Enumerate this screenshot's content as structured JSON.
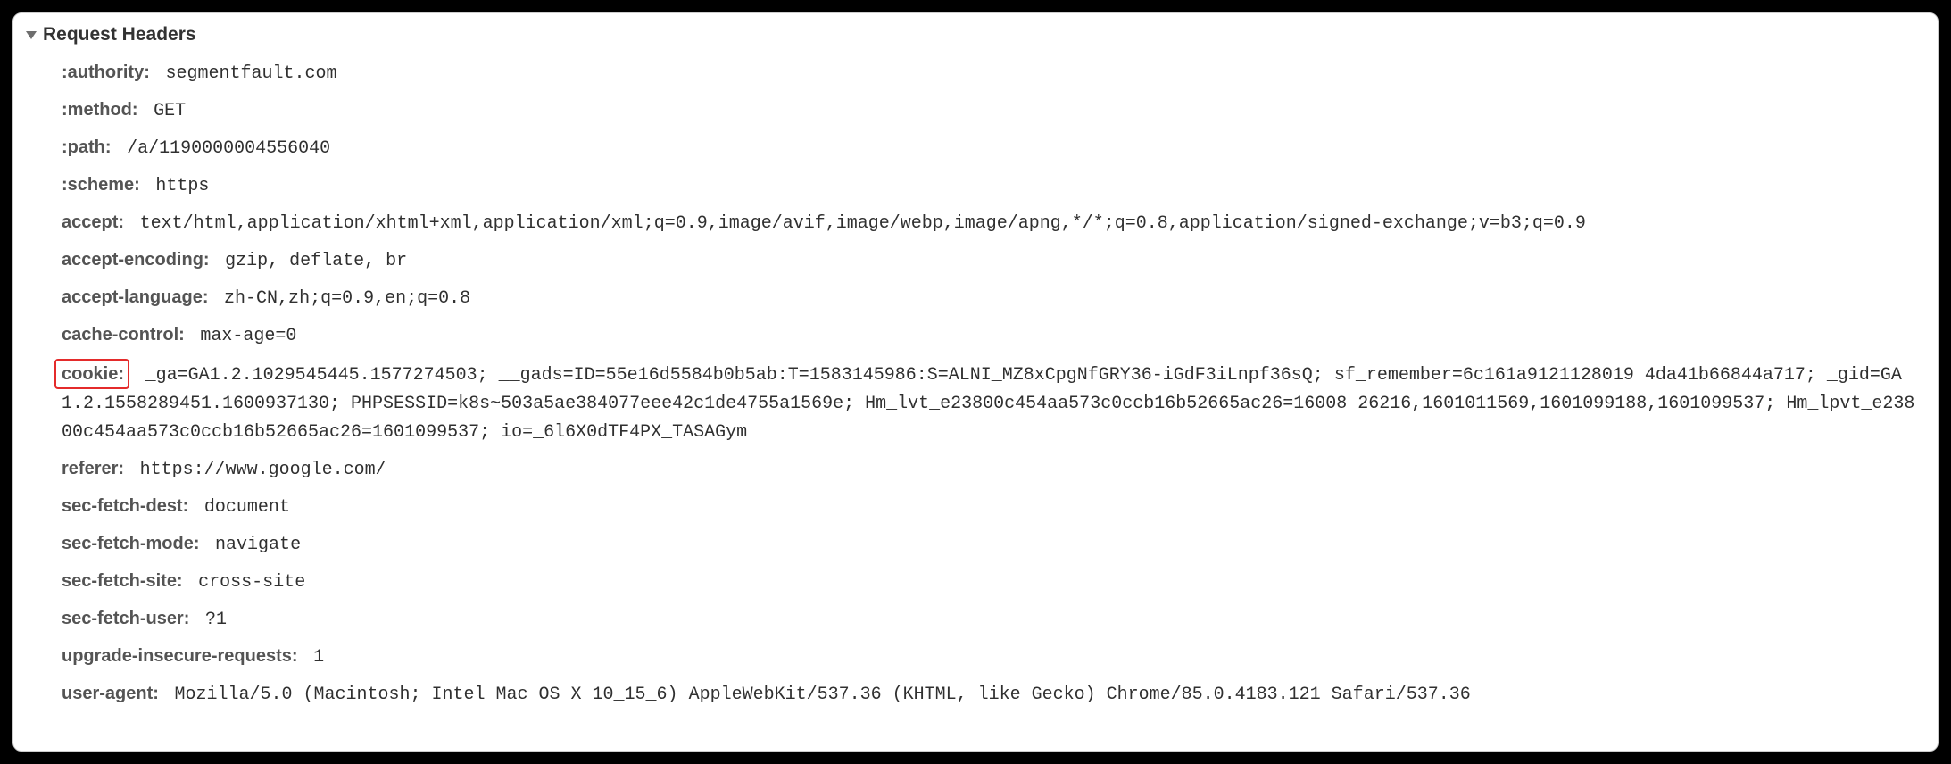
{
  "section_title": "Request Headers",
  "headers": {
    "authority": {
      "name": ":authority:",
      "value": "segmentfault.com"
    },
    "method": {
      "name": ":method:",
      "value": "GET"
    },
    "path": {
      "name": ":path:",
      "value": "/a/1190000004556040"
    },
    "scheme": {
      "name": ":scheme:",
      "value": "https"
    },
    "accept": {
      "name": "accept:",
      "value": "text/html,application/xhtml+xml,application/xml;q=0.9,image/avif,image/webp,image/apng,*/*;q=0.8,application/signed-exchange;v=b3;q=0.9"
    },
    "accept_encoding": {
      "name": "accept-encoding:",
      "value": "gzip, deflate, br"
    },
    "accept_language": {
      "name": "accept-language:",
      "value": "zh-CN,zh;q=0.9,en;q=0.8"
    },
    "cache_control": {
      "name": "cache-control:",
      "value": "max-age=0"
    },
    "cookie": {
      "name": "cookie:",
      "value": "_ga=GA1.2.1029545445.1577274503; __gads=ID=55e16d5584b0b5ab:T=1583145986:S=ALNI_MZ8xCpgNfGRY36-iGdF3iLnpf36sQ; sf_remember=6c161a9121128019 4da41b66844a717; _gid=GA1.2.1558289451.1600937130; PHPSESSID=k8s~503a5ae384077eee42c1de4755a1569e; Hm_lvt_e23800c454aa573c0ccb16b52665ac26=16008 26216,1601011569,1601099188,1601099537; Hm_lpvt_e23800c454aa573c0ccb16b52665ac26=1601099537; io=_6l6X0dTF4PX_TASAGym"
    },
    "referer": {
      "name": "referer:",
      "value": "https://www.google.com/"
    },
    "sec_fetch_dest": {
      "name": "sec-fetch-dest:",
      "value": "document"
    },
    "sec_fetch_mode": {
      "name": "sec-fetch-mode:",
      "value": "navigate"
    },
    "sec_fetch_site": {
      "name": "sec-fetch-site:",
      "value": "cross-site"
    },
    "sec_fetch_user": {
      "name": "sec-fetch-user:",
      "value": "?1"
    },
    "upgrade_insecure_requests": {
      "name": "upgrade-insecure-requests:",
      "value": "1"
    },
    "user_agent": {
      "name": "user-agent:",
      "value": "Mozilla/5.0 (Macintosh; Intel Mac OS X 10_15_6) AppleWebKit/537.36 (KHTML, like Gecko) Chrome/85.0.4183.121 Safari/537.36"
    }
  }
}
